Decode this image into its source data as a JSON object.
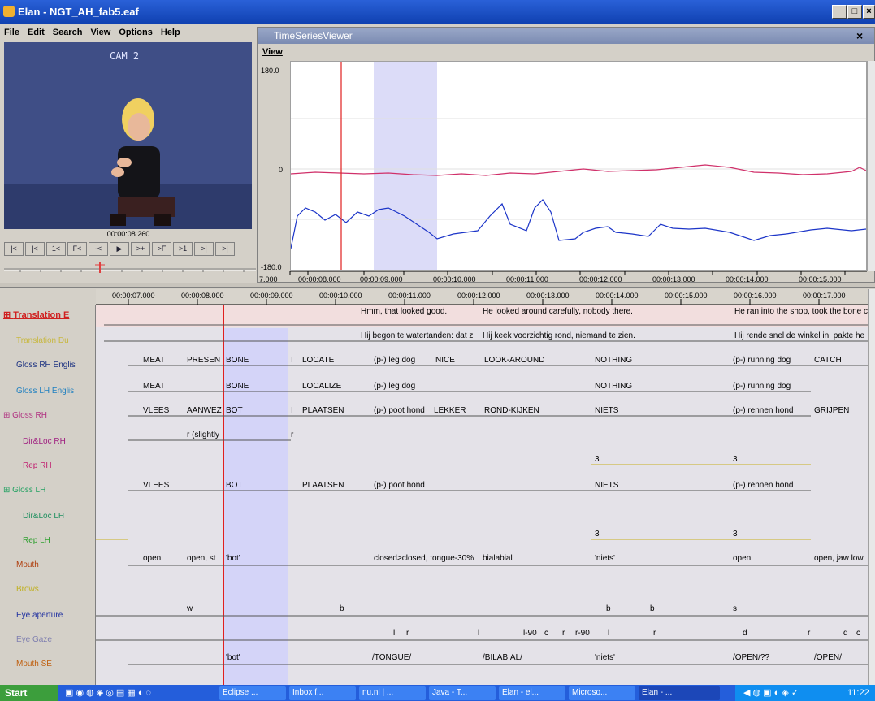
{
  "window": {
    "title": "Elan - NGT_AH_fab5.eaf"
  },
  "menu": [
    "File",
    "Edit",
    "Search",
    "View",
    "Options",
    "Help"
  ],
  "video": {
    "cam_label": "CAM 2",
    "timecode": "00:00:08.260"
  },
  "controls": [
    "|<",
    "|<",
    "1<",
    "F<",
    "-<",
    "▶",
    ">+",
    ">F",
    ">1",
    ">|",
    ">|"
  ],
  "tsv": {
    "title": "TimeSeriesViewer",
    "menu": "View",
    "y_labels": [
      "180.0",
      "0",
      "-180.0"
    ],
    "x_labels": [
      "7.000",
      "00:00:08.000",
      "00:00:09.000",
      "00:00:10.000",
      "00:00:11.000",
      "00:00:12.000",
      "00:00:13.000",
      "00:00:14.000",
      "00:00:15.000",
      "00:00:16.000"
    ],
    "series_colors": [
      "#d0306a",
      "#1c35c8"
    ]
  },
  "timeline": {
    "labels": [
      "00:00:07.000",
      "00:00:08.000",
      "00:00:09.000",
      "00:00:10.000",
      "00:00:11.000",
      "00:00:12.000",
      "00:00:13.000",
      "00:00:14.000",
      "00:00:15.000",
      "00:00:16.000",
      "00:00:17.000"
    ]
  },
  "tiers": [
    {
      "name": "Translation E",
      "color": "#d02020"
    },
    {
      "name": "Translation Du",
      "color": "#c8b840"
    },
    {
      "name": "Gloss RH Englis",
      "color": "#1a3080"
    },
    {
      "name": "Gloss LH Englis",
      "color": "#2080c0"
    },
    {
      "name": "Gloss RH",
      "color": "#b03080"
    },
    {
      "name": "Dir&Loc RH",
      "color": "#a02080"
    },
    {
      "name": "Rep RH",
      "color": "#c02070"
    },
    {
      "name": "Gloss LH",
      "color": "#20a060"
    },
    {
      "name": "Dir&Loc LH",
      "color": "#209060"
    },
    {
      "name": "Rep LH",
      "color": "#30a030"
    },
    {
      "name": "Mouth",
      "color": "#b04010"
    },
    {
      "name": "Brows",
      "color": "#c0b020"
    },
    {
      "name": "Eye aperture",
      "color": "#2030a0"
    },
    {
      "name": "Eye Gaze",
      "color": "#8080b0"
    },
    {
      "name": "Mouth SE",
      "color": "#c06010"
    }
  ],
  "annotations": [
    [
      "Hmm, that looked good.",
      "He looked around carefully, nobody there.",
      "He ran into the shop, took the bone c"
    ],
    [
      "Hij begon te watertanden: dat zi",
      "Hij keek voorzichtig rond, niemand te zien.",
      "Hij rende snel de winkel in, pakte he"
    ],
    [
      "MEAT",
      "PRESEN",
      "BONE",
      "I",
      "LOCATE",
      "(p-) leg dog",
      "NICE",
      "LOOK-AROUND",
      "NOTHING",
      "(p-) running dog",
      "CATCH"
    ],
    [
      "MEAT",
      "BONE",
      "LOCALIZE",
      "(p-) leg dog",
      "NOTHING",
      "(p-) running dog"
    ],
    [
      "VLEES",
      "AANWEZ",
      "BOT",
      "I",
      "PLAATSEN",
      "(p-) poot hond",
      "LEKKER",
      "ROND-KIJKEN",
      "NIETS",
      "(p-) rennen hond",
      "GRIJPEN"
    ],
    [
      "r (slightly",
      "r"
    ],
    [
      "3",
      "3"
    ],
    [
      "VLEES",
      "BOT",
      "PLAATSEN",
      "(p-) poot hond",
      "NIETS",
      "(p-) rennen hond"
    ],
    [],
    [
      "3",
      "3"
    ],
    [
      "open",
      "open, st",
      "'bot'",
      "closed>closed, tongue-30%",
      "bialabial",
      "'niets'",
      "open",
      "open, jaw low"
    ],
    [],
    [
      "w",
      "b",
      "b",
      "b",
      "s"
    ],
    [
      "l",
      "r",
      "l",
      "l-90",
      "c",
      "r",
      "r-90",
      "l",
      "r",
      "d",
      "r",
      "d",
      "c"
    ],
    [
      "'bot'",
      "/TONGUE/",
      "/BILABIAL/",
      "'niets'",
      "/OPEN/??",
      "/OPEN/"
    ]
  ],
  "taskbar": {
    "start": "Start",
    "items": [
      "Eclipse ...",
      "Inbox f...",
      "nu.nl | ...",
      "Java - T...",
      "Elan - el...",
      "Microso...",
      "Elan - ..."
    ],
    "clock": "11:22"
  }
}
